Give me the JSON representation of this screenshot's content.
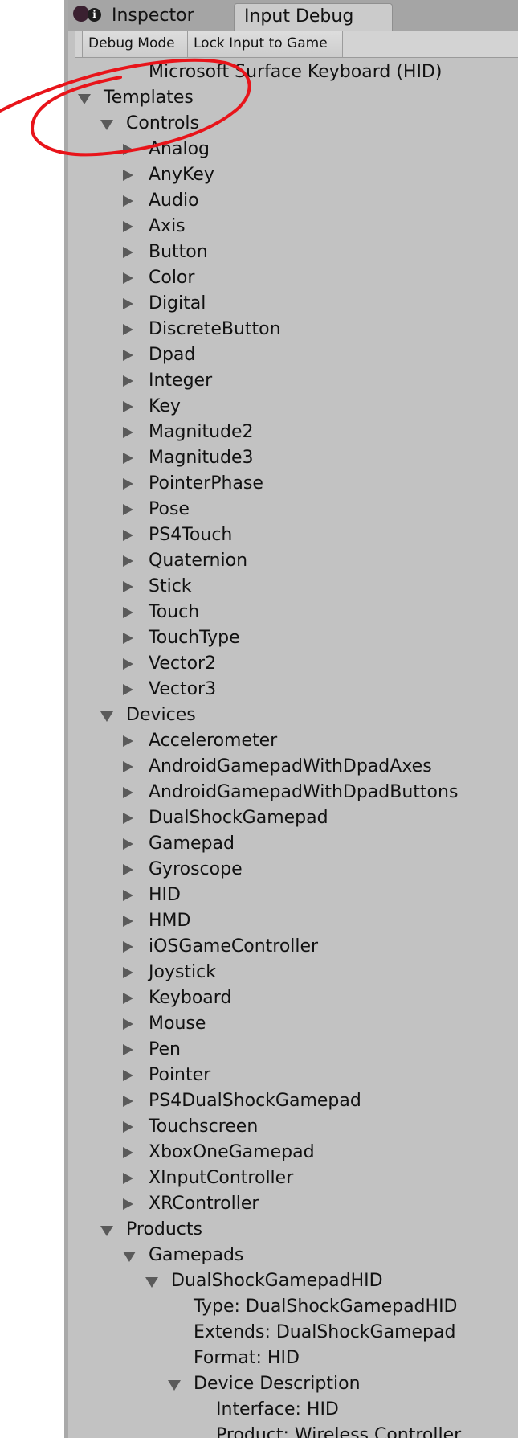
{
  "tabs": {
    "inspector": "Inspector",
    "input_debug": "Input Debug"
  },
  "toolbar": {
    "debug_mode": "Debug Mode",
    "lock_input": "Lock Input to Game"
  },
  "tree": {
    "partial_row": "Microsoft Surface Keyboard (HID)",
    "templates": "Templates",
    "controls": {
      "label": "Controls",
      "items": [
        "Analog",
        "AnyKey",
        "Audio",
        "Axis",
        "Button",
        "Color",
        "Digital",
        "DiscreteButton",
        "Dpad",
        "Integer",
        "Key",
        "Magnitude2",
        "Magnitude3",
        "PointerPhase",
        "Pose",
        "PS4Touch",
        "Quaternion",
        "Stick",
        "Touch",
        "TouchType",
        "Vector2",
        "Vector3"
      ]
    },
    "devices": {
      "label": "Devices",
      "items": [
        "Accelerometer",
        "AndroidGamepadWithDpadAxes",
        "AndroidGamepadWithDpadButtons",
        "DualShockGamepad",
        "Gamepad",
        "Gyroscope",
        "HID",
        "HMD",
        "iOSGameController",
        "Joystick",
        "Keyboard",
        "Mouse",
        "Pen",
        "Pointer",
        "PS4DualShockGamepad",
        "Touchscreen",
        "XboxOneGamepad",
        "XInputController",
        "XRController"
      ]
    },
    "products": {
      "label": "Products",
      "gamepads": {
        "label": "Gamepads",
        "dualshock_hid": {
          "label": "DualShockGamepadHID",
          "type": "Type: DualShockGamepadHID",
          "extends": "Extends: DualShockGamepad",
          "format": "Format: HID",
          "device_description": {
            "label": "Device Description",
            "interface": "Interface: HID",
            "product": "Product: Wireless Controller"
          }
        }
      }
    }
  },
  "colors": {
    "panel_bg": "#c2c2c2",
    "tab_strip_bg": "#a5a5a5",
    "annotation_stroke": "#e8141a"
  },
  "icons": {
    "tab_dot": "dot-icon",
    "tab_info": "info-icon",
    "collapsed": "triangle-right-icon",
    "expanded": "triangle-down-icon"
  }
}
